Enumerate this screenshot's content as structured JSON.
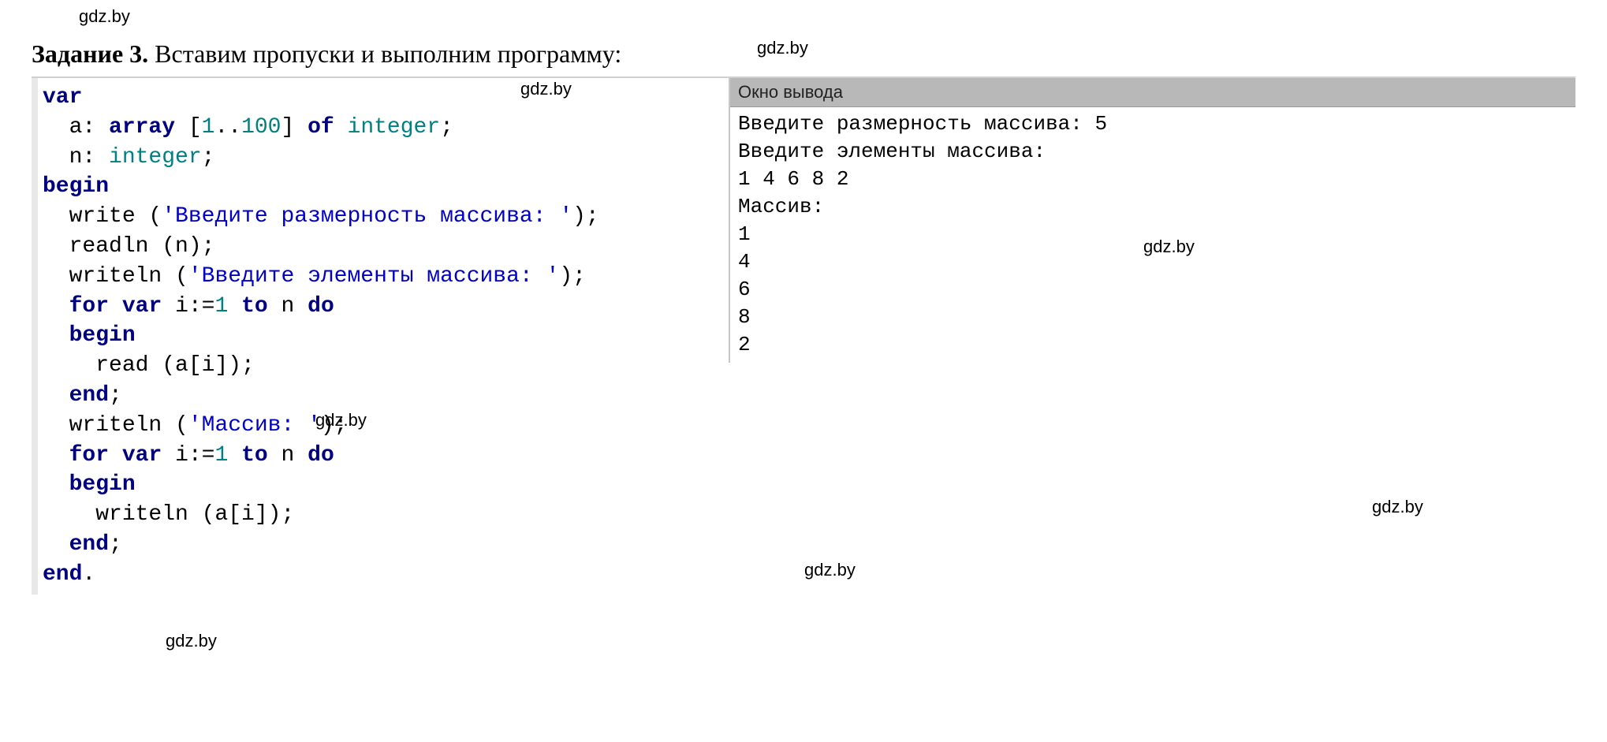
{
  "watermarks": {
    "w1": "gdz.by",
    "w2": "gdz.by",
    "w3": "gdz.by",
    "w4": "gdz.by",
    "w5": "gdz.by",
    "w6": "gdz.by",
    "w7": "gdz.by",
    "w8": "gdz.by"
  },
  "task": {
    "label": "Задание 3.",
    "text": " Вставим пропуски и выполним программу:"
  },
  "code": {
    "l1_kw": "var",
    "l2_a": "  a: ",
    "l2_kw": "array",
    "l2_b": " [",
    "l2_n1": "1",
    "l2_dots": "..",
    "l2_n2": "100",
    "l2_c": "] ",
    "l2_of": "of",
    "l2_sp": " ",
    "l2_type": "integer",
    "l2_end": ";",
    "l3_a": "  n: ",
    "l3_type": "integer",
    "l3_end": ";",
    "l4_kw": "begin",
    "l5_a": "  write (",
    "l5_str": "'Введите размерность массива: '",
    "l5_b": ");",
    "l6": "  readln (n);",
    "l7_a": "  writeln (",
    "l7_str": "'Введите элементы массива: '",
    "l7_b": ");",
    "l8_a": "  ",
    "l8_for": "for",
    "l8_b": " ",
    "l8_var": "var",
    "l8_c": " i:=",
    "l8_n1": "1",
    "l8_d": " ",
    "l8_to": "to",
    "l8_e": " n ",
    "l8_do": "do",
    "l9_a": "  ",
    "l9_kw": "begin",
    "l10": "    read (a[i]);",
    "l11_a": "  ",
    "l11_kw": "end",
    "l11_b": ";",
    "l12_a": "  writeln (",
    "l12_str": "'Массив: '",
    "l12_b": ");",
    "l13_a": "  ",
    "l13_for": "for",
    "l13_b": " ",
    "l13_var": "var",
    "l13_c": " i:=",
    "l13_n1": "1",
    "l13_d": " ",
    "l13_to": "to",
    "l13_e": " n ",
    "l13_do": "do",
    "l14_a": "  ",
    "l14_kw": "begin",
    "l15": "    writeln (a[i]);",
    "l16_a": "  ",
    "l16_kw": "end",
    "l16_b": ";",
    "l17_kw": "end",
    "l17_b": "."
  },
  "output": {
    "header": "Окно вывода",
    "l1": "Введите размерность массива: 5",
    "l2": "Введите элементы массива:",
    "l3": "1 4 6 8 2",
    "l4": "Массив:",
    "l5": "1",
    "l6": "4",
    "l7": "6",
    "l8": "8",
    "l9": "2"
  }
}
